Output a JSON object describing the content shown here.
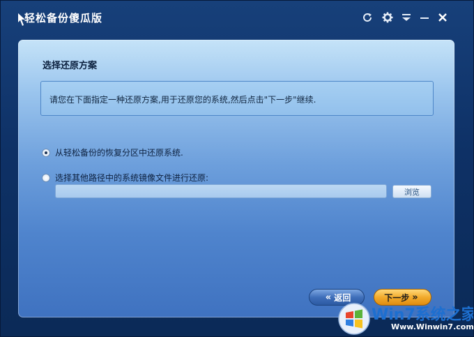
{
  "app": {
    "title": "轻松备份傻瓜版"
  },
  "titlebar": {
    "icons": [
      "refresh-icon",
      "gear-icon",
      "menu-icon",
      "minimize-icon",
      "close-icon"
    ]
  },
  "main": {
    "section_title": "选择还原方案",
    "description": "请您在下面指定一种还原方案,用于还原您的系统,然后点击\"下一步\"继续.",
    "options": [
      {
        "label": "从轻松备份的恢复分区中还原系统.",
        "checked": true
      },
      {
        "label": "选择其他路径中的系统镜像文件进行还原:",
        "checked": false
      }
    ],
    "path_input": {
      "value": ""
    },
    "browse_label": "浏览"
  },
  "footer": {
    "back_label": "返回",
    "next_label": "下一步"
  },
  "watermark": {
    "brand": "Win7系统之家",
    "url": "Www.Winwin7.com"
  },
  "colors": {
    "title_bar": "#123a72",
    "panel_top": "#c5e3f8",
    "panel_bottom": "#3f72c0",
    "next_button": "#f2ab2c",
    "back_button": "#3f6fba"
  }
}
